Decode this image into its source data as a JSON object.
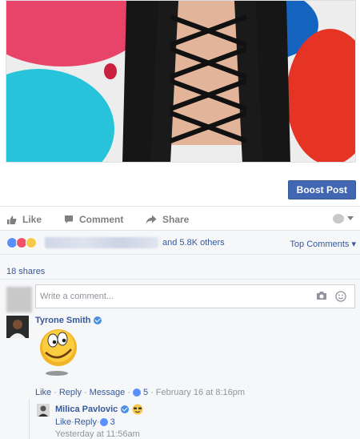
{
  "post": {
    "boost_label": "Boost Post"
  },
  "actions": {
    "like": "Like",
    "comment": "Comment",
    "share": "Share"
  },
  "reactions": {
    "others_text": "and 5.8K others",
    "top_comments": "Top Comments",
    "shares_text": "18 shares"
  },
  "composer": {
    "placeholder": "Write a comment..."
  },
  "comment": {
    "author": "Tyrone Smith",
    "like": "Like",
    "reply": "Reply",
    "message": "Message",
    "like_count": "5",
    "time": "February 16 at 8:16pm"
  },
  "reply": {
    "author": "Milica Pavlovic",
    "like": "Like",
    "reply": "Reply",
    "like_count": "3",
    "time": "Yesterday at 11:56am"
  },
  "colors": {
    "accent": "#4267b2",
    "link": "#365899",
    "muted": "#90949c"
  }
}
